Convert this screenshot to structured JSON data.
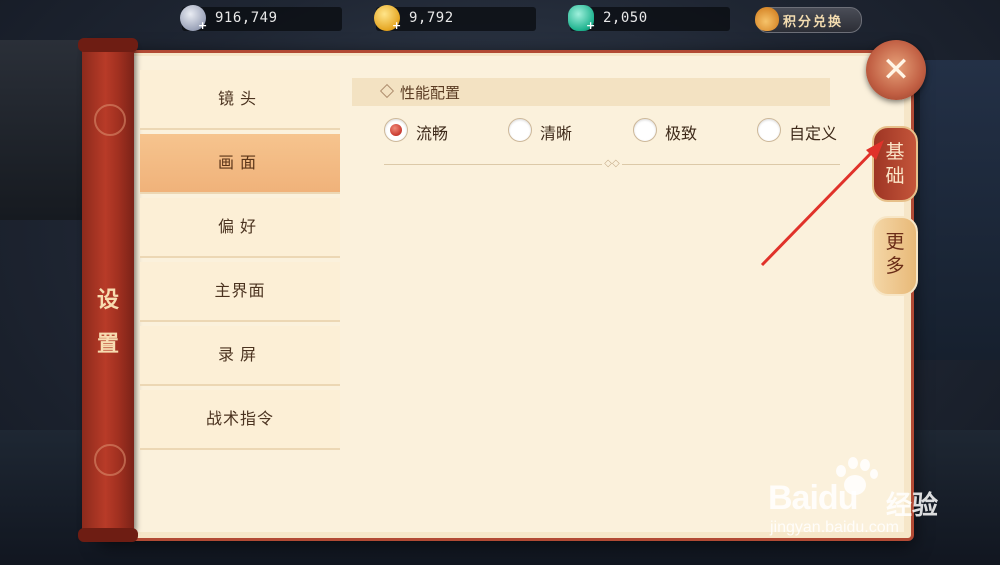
{
  "currencies": [
    {
      "icon": "silver-coin-icon",
      "value": "916,749"
    },
    {
      "icon": "gold-coin-icon",
      "value": "9,792"
    },
    {
      "icon": "jade-icon",
      "value": "2,050"
    }
  ],
  "exchange": {
    "label": "积分兑换",
    "icon": "bag-icon"
  },
  "panel": {
    "title": "设置"
  },
  "menu": [
    {
      "label": "镜头",
      "active": false
    },
    {
      "label": "画面",
      "active": true
    },
    {
      "label": "偏好",
      "active": false
    },
    {
      "label": "主界面",
      "active": false
    },
    {
      "label": "录屏",
      "active": false
    },
    {
      "label": "战术指令",
      "active": false
    }
  ],
  "section": {
    "title": "性能配置",
    "options": [
      {
        "label": "流畅",
        "checked": true
      },
      {
        "label": "清晰",
        "checked": false
      },
      {
        "label": "极致",
        "checked": false
      },
      {
        "label": "自定义",
        "checked": false
      }
    ]
  },
  "side_tabs": [
    {
      "label_line1": "基",
      "label_line2": "础",
      "active": true
    },
    {
      "label_line1": "更",
      "label_line2": "多",
      "active": false
    }
  ],
  "close": {
    "icon": "close-icon"
  },
  "watermark": {
    "brand": "Bai",
    "brand2": "du",
    "cn": "经验",
    "url": "jingyan.baidu.com"
  },
  "colors": {
    "accent_red": "#b24a34",
    "panel_bg": "#f6e6c8",
    "active_tab": "#f0b27a",
    "arrow": "#e0322a"
  }
}
